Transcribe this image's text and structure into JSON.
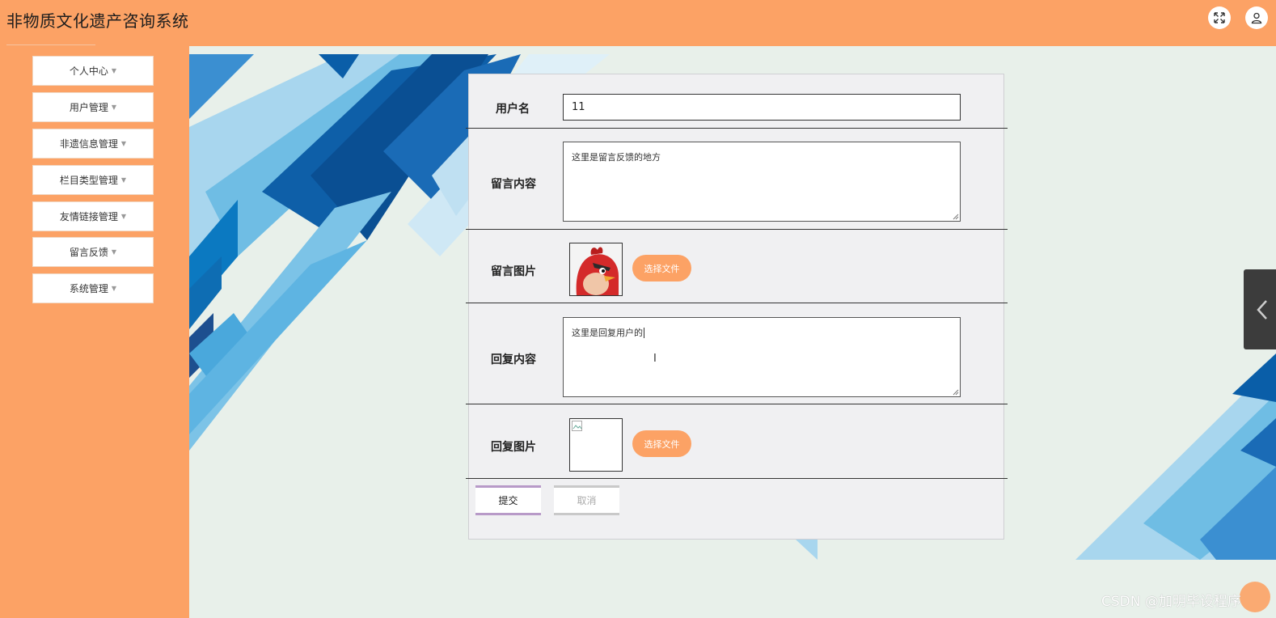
{
  "header": {
    "title": "非物质文化遗产咨询系统",
    "fullscreen_icon": "expand-icon",
    "user_icon": "user-icon"
  },
  "sidebar": {
    "items": [
      {
        "label": "个人中心"
      },
      {
        "label": "用户管理"
      },
      {
        "label": "非遗信息管理"
      },
      {
        "label": "栏目类型管理"
      },
      {
        "label": "友情链接管理"
      },
      {
        "label": "留言反馈"
      },
      {
        "label": "系统管理"
      }
    ]
  },
  "form": {
    "username_label": "用户名",
    "username_value": "11",
    "content_label": "留言内容",
    "content_value": "这里是留言反馈的地方",
    "image_label": "留言图片",
    "reply_label": "回复内容",
    "reply_value": "这里是回复用户的",
    "reply_image_label": "回复图片",
    "choose_file": "选择文件",
    "submit": "提交",
    "cancel": "取消"
  },
  "watermark": "CSDN @加明毕设程序",
  "colors": {
    "accent": "#fca265",
    "background": "#e8f0ea",
    "panel": "#f0f0f2"
  }
}
